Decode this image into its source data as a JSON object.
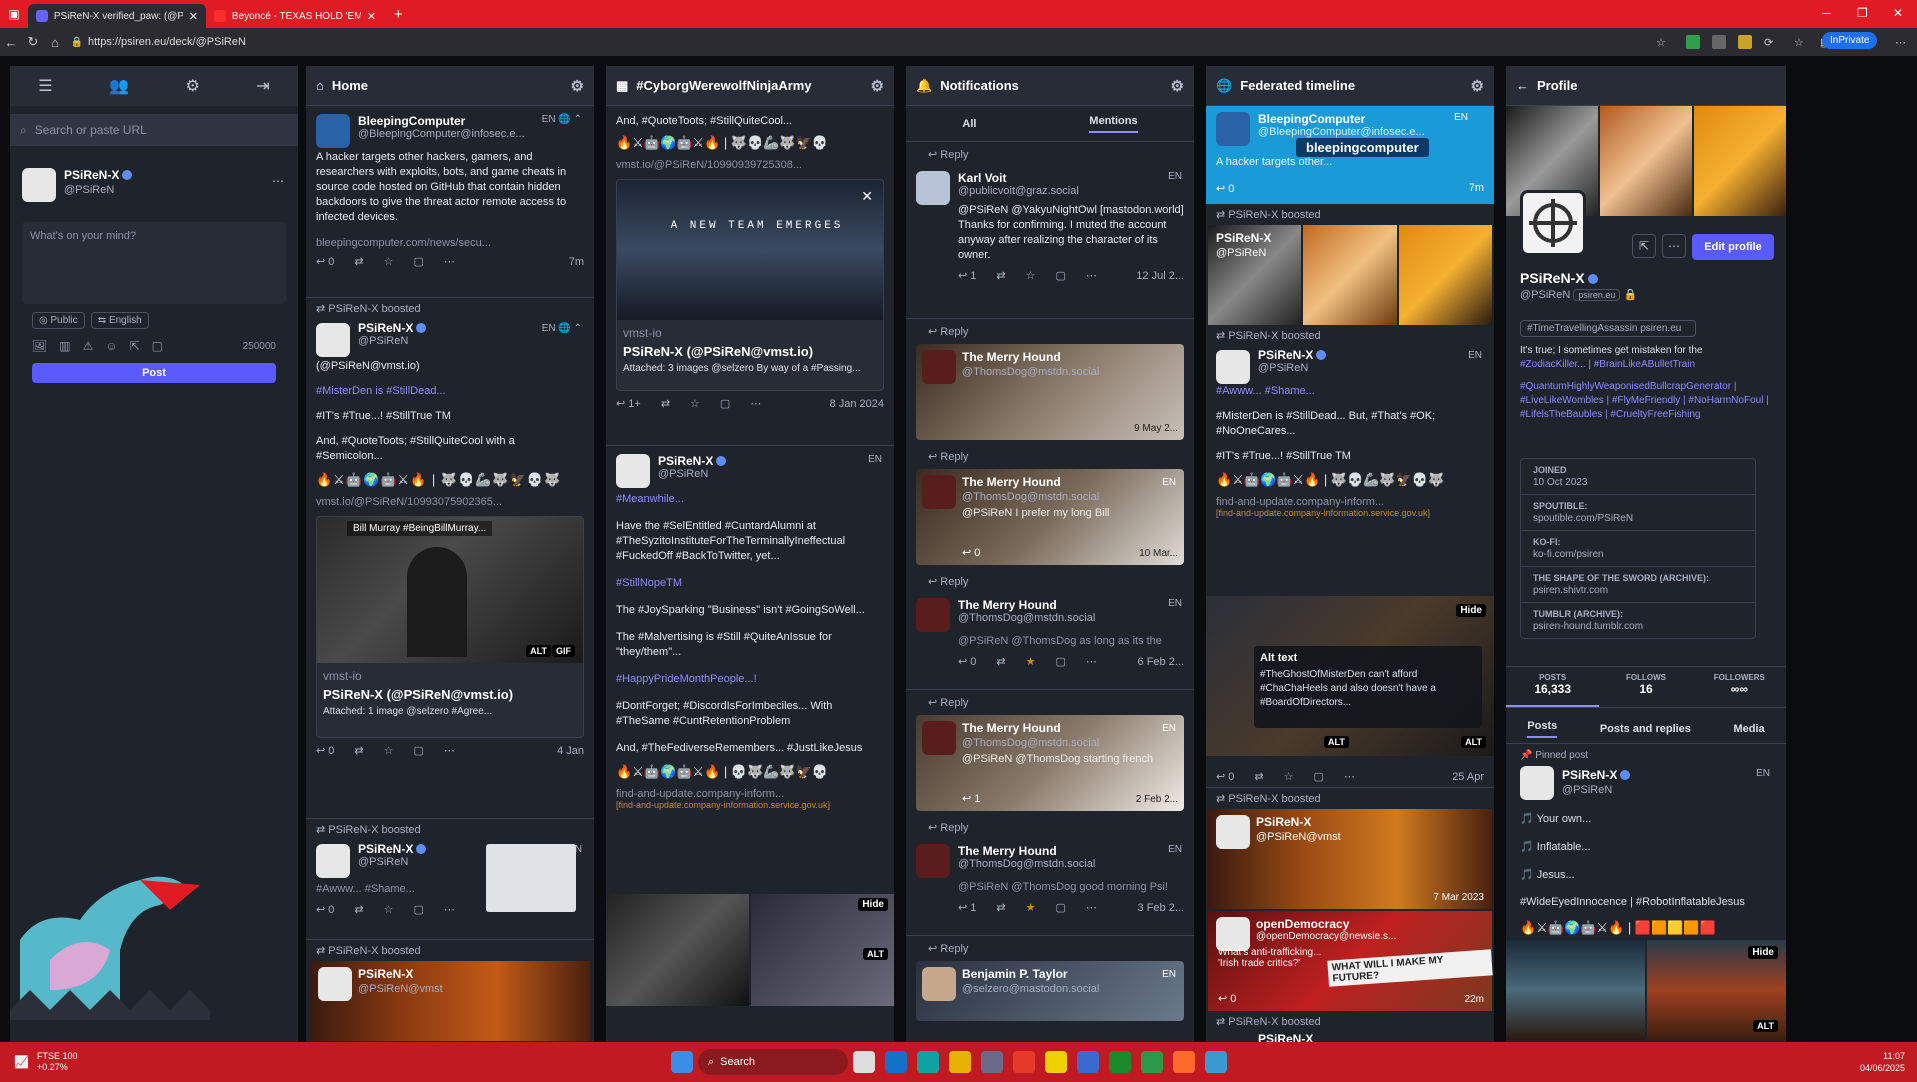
{
  "browser": {
    "tabs": [
      {
        "label": "PSiReN-X verified_paw: (@PSiReN"
      },
      {
        "label": "Beyoncé - TEXAS HOLD 'EM [Dev"
      }
    ],
    "url": "https://psiren.eu/deck/@PSiReN",
    "inprivate": "InPrivate"
  },
  "compose": {
    "search_placeholder": "Search or paste URL",
    "user_name": "PSiReN-X",
    "user_handle": "@PSiReN",
    "placeholder": "What's on your mind?",
    "visibility": "Public",
    "language": "English",
    "char_count": "250000",
    "post_label": "Post"
  },
  "home": {
    "title": "Home",
    "post1": {
      "name": "BleepingComputer",
      "handle": "@BleepingComputer@infosec.e...",
      "lang": "EN",
      "text": "A hacker targets other hackers, gamers, and researchers with exploits, bots, and game cheats in source code hosted on GitHub that contain hidden backdoors to give the threat actor remote access to infected devices.",
      "link": "bleepingcomputer.com/news/secu...",
      "replies": "0",
      "time": "7m"
    },
    "boost1": {
      "booster": "PSiReN-X",
      "boosted": "boosted",
      "name": "PSiReN-X",
      "handle": "@PSiReN",
      "lang": "EN",
      "mention": "(@PSiReN@vmst.io)",
      "line1": "#MisterDen is #StillDead...",
      "line2": "#IT's #True...! #StillTrue TM",
      "line3": "And, #QuoteToots; #StillQuiteCool with a #Semicolon...",
      "link": "vmst.io/@PSiReN/10993075902365...",
      "card_caption": "Bill Murray #BeingBillMurray...",
      "alt": "ALT",
      "gif": "GIF",
      "card_host": "vmst-io",
      "card_title": "PSiReN-X (@PSiReN@vmst.io)",
      "card_desc": "Attached: 1 image @selzero #Agree...",
      "replies": "0",
      "time": "4 Jan"
    },
    "boost2": {
      "booster": "PSiReN-X",
      "boosted": "boosted",
      "name": "PSiReN-X",
      "handle": "@PSiReN",
      "lang": "EN",
      "text": "#Awww... #Shame...",
      "replies": "0"
    },
    "boost3": {
      "booster": "PSiReN-X",
      "boosted": "boosted",
      "name": "PSiReN-X",
      "handle": "@PSiReN@vmst"
    }
  },
  "cyborg": {
    "title": "#CyborgWerewolfNinjaArmy",
    "post1": {
      "line1": "And, #QuoteToots; #StillQuiteCool...",
      "link": "vmst.io/@PSiReN/10990939725308...",
      "card_banner": "A NEW TEAM EMERGES",
      "card_host": "vmst-io",
      "card_title": "PSiReN-X (@PSiReN@vmst.io)",
      "card_desc": "Attached: 3 images @selzero By way of a #Passing...",
      "replies": "1+",
      "time": "8 Jan 2024"
    },
    "post2": {
      "name": "PSiReN-X",
      "handle": "@PSiReN",
      "lang": "EN",
      "line1": "#Meanwhile...",
      "line2": "Have the #SelEntitled #CuntardAlumni at #TheSyzitoInstituteForTheTerminallyIneffectual #FuckedOff #BackToTwitter, yet...",
      "line3": "#StillNopeTM",
      "line4": "The #JoySparking \"Business\" isn't #GoingSoWell...",
      "line5": "The #Malvertising is #Still #QuiteAnIssue for \"they/them\"...",
      "line6": "#HappyPrideMonthPeople...!",
      "line7": "#DontForget; #DiscordIsForImbeciles... With #TheSame #CuntRetentionProblem",
      "line8": "And, #TheFediverseRemembers... #JustLikeJesus",
      "link": "find-and-update.company-inform...",
      "link_detail": "[find-and-update.company-information.service.gov.uk]",
      "hide": "Hide",
      "alt": "ALT"
    }
  },
  "notifications": {
    "title": "Notifications",
    "tabs": [
      "All",
      "Mentions"
    ],
    "reply_label": "Reply",
    "items": [
      {
        "name": "Karl Voit",
        "handle": "@publicvoit@graz.social",
        "lang": "EN",
        "text": "@PSiReN @YakyuNightOwl [mastodon.world] Thanks for confirming. I muted the account anyway after realizing the character of its owner.",
        "replies": "1",
        "time": "12 Jul 2..."
      },
      {
        "name": "The Merry Hound",
        "handle": "@ThomsDog@mstdn.social",
        "lang": "EN",
        "time": "9 May 2..."
      },
      {
        "name": "The Merry Hound",
        "handle": "@ThomsDog@mstdn.social",
        "lang": "EN",
        "text": "@PSiReN I prefer my long Bill",
        "replies": "0",
        "time": "10 Mar..."
      },
      {
        "name": "The Merry Hound",
        "handle": "@ThomsDog@mstdn.social",
        "lang": "EN",
        "text": "@PSiReN @ThomsDog as long as its the",
        "replies": "0",
        "time": "6 Feb 2..."
      },
      {
        "name": "The Merry Hound",
        "handle": "@ThomsDog@mstdn.social",
        "lang": "EN",
        "text": "@PSiReN @ThomsDog starting french",
        "replies": "1",
        "time": "2 Feb 2..."
      },
      {
        "name": "The Merry Hound",
        "handle": "@ThomsDog@mstdn.social",
        "lang": "EN",
        "text": "@PSiReN @ThomsDog good morning Psi!",
        "replies": "1",
        "time": "3 Feb 2..."
      },
      {
        "name": "Benjamin P. Taylor",
        "handle": "@selzero@mastodon.social",
        "lang": "EN"
      }
    ]
  },
  "federated": {
    "title": "Federated timeline",
    "post1": {
      "name": "BleepingComputer",
      "handle": "@BleepingComputer@infosec.e...",
      "lang": "EN",
      "banner": "bleepingcomputer",
      "text": "A hacker targets other...",
      "replies": "0",
      "time": "7m"
    },
    "boost1": {
      "booster": "PSiReN-X",
      "boosted": "boosted",
      "name": "PSiReN-X",
      "handle": "@PSiReN"
    },
    "boost2": {
      "booster": "PSiReN-X",
      "boosted": "boosted",
      "name": "PSiReN-X",
      "handle": "@PSiReN",
      "lang": "EN",
      "line1": "#Awww... #Shame...",
      "line2": "#MisterDen is #StillDead... But, #That's #OK; #NoOneCares...",
      "line3": "#IT's #True...! #StillTrue TM",
      "link": "find-and-update.company-inform...",
      "link_detail": "[find-and-update.company-information.service.gov.uk]",
      "hide": "Hide",
      "alt_title": "Alt text",
      "alt_text": "#TheGhostOfMisterDen can't afford #ChaChaHeels and also doesn't have a #BoardOfDirectors...",
      "alt": "ALT",
      "replies": "0",
      "time": "25 Apr"
    },
    "boost3": {
      "booster": "PSiReN-X",
      "boosted": "boosted",
      "name": "PSiReN-X",
      "handle": "@PSiReN@vmst",
      "time": "7 Mar 2023"
    },
    "post2": {
      "name": "openDemocracy",
      "handle": "@openDemocracy@newsie.s...",
      "text": "What's anti-trafficking... 'Irish trade critics?'",
      "sign": "WHAT WILL I MAKE MY FUTURE?",
      "replies": "0",
      "time": "22m"
    },
    "boost4": {
      "booster": "PSiReN-X",
      "boosted": "boosted",
      "name": "PSiReN-X"
    }
  },
  "profile": {
    "title": "Profile",
    "edit": "Edit profile",
    "name": "PSiReN-X",
    "handle": "@PSiReN",
    "domain_tag": "psiren.eu",
    "tagline": "#TimeTravellingAssassin",
    "tagline_domain": "psiren.eu",
    "bio1": "It's true; I sometimes get mistaken for the",
    "bio2": "#ZodiacKiller... | #BrainLikeABulletTrain",
    "bio3": "#QuantumHighlyWeaponisedBullcrapGenerator | #LiveLikeWombles | #FlyMeFriendly | #NoHarmNoFoul | #LifelsTheBaubles | #CrueltyFreeFishing",
    "fields": [
      {
        "k": "JOINED",
        "v": "10 Oct 2023"
      },
      {
        "k": "SPOUTIBLE:",
        "v": "spoutible.com/PSiReN"
      },
      {
        "k": "KO-FI:",
        "v": "ko-fi.com/psiren"
      },
      {
        "k": "THE SHAPE OF THE SWORD (ARCHIVE):",
        "v": "psiren.shivtr.com"
      },
      {
        "k": "TUMBLR (ARCHIVE):",
        "v": "psiren-hound.tumblr.com"
      }
    ],
    "stats": [
      {
        "k": "POSTS",
        "v": "16,333"
      },
      {
        "k": "FOLLOWS",
        "v": "16"
      },
      {
        "k": "FOLLOWERS",
        "v": "∞∞"
      }
    ],
    "tabs": [
      "Posts",
      "Posts and replies",
      "Media"
    ],
    "pinned": "Pinned post",
    "pin_name": "PSiReN-X",
    "pin_handle": "@PSiReN",
    "pin_lang": "EN",
    "pin1": "Your own...",
    "pin2": "Inflatable...",
    "pin3": "Jesus...",
    "pin4": "#WideEyedInnocence | #RobotInflatableJesus",
    "hide": "Hide",
    "alt": "ALT"
  },
  "taskbar": {
    "ticker": "FTSE 100",
    "ticker_change": "+0.27%",
    "search": "Search",
    "time": "11:07",
    "date": "04/06/2025"
  },
  "colors": {
    "accent": "#595aff",
    "tabbar": "#e01b24",
    "taskbar": "#c11a22",
    "link": "#8c8dff"
  }
}
